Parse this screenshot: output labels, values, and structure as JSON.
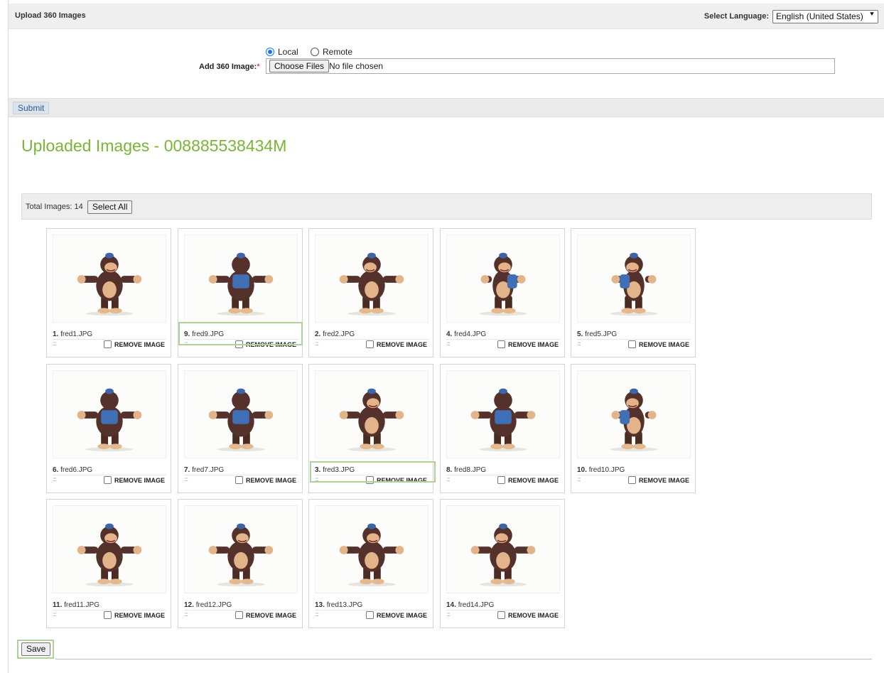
{
  "header": {
    "title": "Upload 360 Images",
    "language_label": "Select Language:",
    "language_value": "English (United States)"
  },
  "upload_form": {
    "source_options": [
      {
        "label": "Local",
        "selected": true
      },
      {
        "label": "Remote",
        "selected": false
      }
    ],
    "add_label": "Add 360 Image:",
    "required_mark": "*",
    "choose_files_label": "Choose Files",
    "file_status": "No file chosen",
    "submit_label": "Submit"
  },
  "gallery": {
    "heading": "Uploaded Images - 008885538434M",
    "total_label": "Total Images: 14",
    "select_all_label": "Select All",
    "remove_label": "REMOVE IMAGE",
    "grip_icon": "::::",
    "images": [
      {
        "index": "1.",
        "filename": "fred1.JPG",
        "pose": "front"
      },
      {
        "index": "9.",
        "filename": "fred9.JPG",
        "pose": "back-left"
      },
      {
        "index": "2.",
        "filename": "fred2.JPG",
        "pose": "front-left"
      },
      {
        "index": "4.",
        "filename": "fred4.JPG",
        "pose": "side-right"
      },
      {
        "index": "5.",
        "filename": "fred5.JPG",
        "pose": "side-left"
      },
      {
        "index": "6.",
        "filename": "fred6.JPG",
        "pose": "back-right"
      },
      {
        "index": "7.",
        "filename": "fred7.JPG",
        "pose": "back"
      },
      {
        "index": "3.",
        "filename": "fred3.JPG",
        "pose": "three-quarter"
      },
      {
        "index": "8.",
        "filename": "fred8.JPG",
        "pose": "back-left"
      },
      {
        "index": "10.",
        "filename": "fred10.JPG",
        "pose": "side-left"
      },
      {
        "index": "11.",
        "filename": "fred11.JPG",
        "pose": "front-right"
      },
      {
        "index": "12.",
        "filename": "fred12.JPG",
        "pose": "front"
      },
      {
        "index": "13.",
        "filename": "fred13.JPG",
        "pose": "front"
      },
      {
        "index": "14.",
        "filename": "fred14.JPG",
        "pose": "front-left"
      }
    ],
    "highlighted_filenames": [
      "fred9.JPG",
      "fred3.JPG"
    ]
  },
  "footer": {
    "save_label": "Save"
  },
  "colors": {
    "heading_green": "#7ab536",
    "highlight_green": "#aed29a",
    "submit_text_blue": "#2a5d95"
  }
}
